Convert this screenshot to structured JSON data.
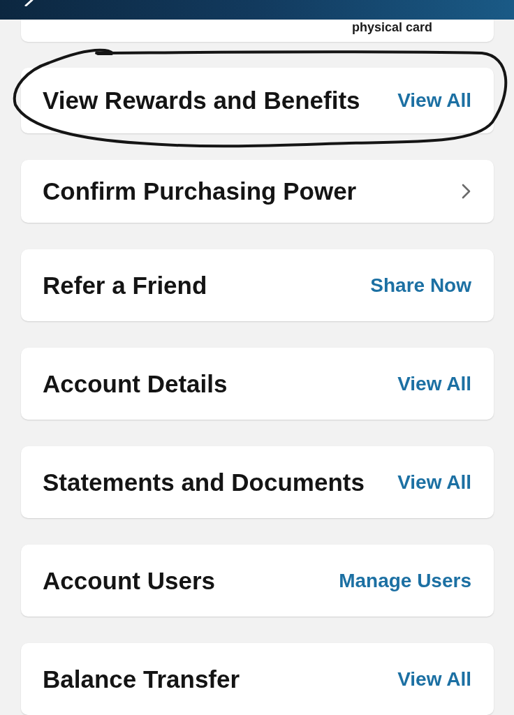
{
  "header": {
    "back_button": true
  },
  "partial_card": {
    "text": "physical card"
  },
  "rows": [
    {
      "title": "View Rewards and Benefits",
      "action": {
        "kind": "link",
        "label": "View All"
      },
      "circled": true
    },
    {
      "title": "Confirm Purchasing Power",
      "action": {
        "kind": "chevron"
      },
      "circled": false
    },
    {
      "title": "Refer a Friend",
      "action": {
        "kind": "link",
        "label": "Share Now"
      },
      "circled": false
    },
    {
      "title": "Account Details",
      "action": {
        "kind": "link",
        "label": "View All"
      },
      "circled": false
    },
    {
      "title": "Statements and Documents",
      "action": {
        "kind": "link",
        "label": "View All"
      },
      "circled": false
    },
    {
      "title": "Account Users",
      "action": {
        "kind": "link",
        "label": "Manage Users"
      },
      "circled": false
    },
    {
      "title": "Balance Transfer",
      "action": {
        "kind": "link",
        "label": "View All"
      },
      "circled": false
    }
  ]
}
